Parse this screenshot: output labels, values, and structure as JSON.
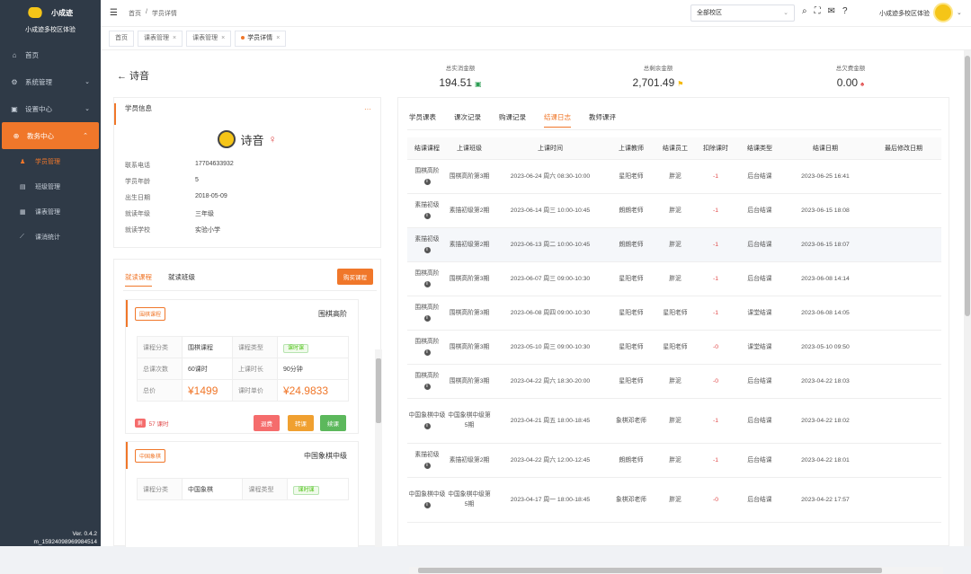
{
  "sidebar": {
    "brand": "小成迹",
    "brand_sub": "小成迹多校区体验",
    "items": [
      {
        "label": "首页",
        "icon": "home-icon"
      },
      {
        "label": "系统管理",
        "icon": "gear-icon"
      },
      {
        "label": "设置中心",
        "icon": "settings-icon"
      },
      {
        "label": "教务中心",
        "icon": "edu-icon"
      }
    ],
    "sub_items": [
      {
        "label": "学员管理"
      },
      {
        "label": "班级管理"
      },
      {
        "label": "课表管理"
      },
      {
        "label": "课消统计"
      }
    ],
    "version": "Ver. 0.4.2",
    "account": "m_15924098969984514"
  },
  "header": {
    "crumb_home": "首页",
    "crumb_sep": "/",
    "crumb_current": "学员详情",
    "campus": "全部校区",
    "user": "小成迹多校区体验"
  },
  "tabs": [
    {
      "label": "首页"
    },
    {
      "label": "课表管理"
    },
    {
      "label": "课表管理"
    },
    {
      "label": "学员详情"
    }
  ],
  "stats": [
    {
      "label": "总实消金额",
      "value": "194.51"
    },
    {
      "label": "总剩余金额",
      "value": "2,701.49"
    },
    {
      "label": "总欠费金额",
      "value": "0.00"
    }
  ],
  "student": {
    "back": "← 诗音",
    "section": "学员信息",
    "more": "···",
    "name": "诗音",
    "gender": "♀",
    "fields": [
      {
        "k": "联系电话",
        "v": "17704633932"
      },
      {
        "k": "学员年龄",
        "v": "5"
      },
      {
        "k": "出生日期",
        "v": "2018-05-09"
      },
      {
        "k": "就读年级",
        "v": "三年级"
      },
      {
        "k": "就读学校",
        "v": "实验小学"
      }
    ]
  },
  "courses": {
    "tab1": "就读课程",
    "tab2": "就读班级",
    "buy": "购买课程",
    "card1": {
      "tag": "围棋课程",
      "title": "围棋高阶",
      "k1": "课程分类",
      "v1": "围棋课程",
      "k2": "课程类型",
      "v2": "课时课",
      "k3": "总课次数",
      "v3": "60课时",
      "k4": "上课时长",
      "v4": "90分钟",
      "k5": "总价",
      "v5": "¥1499",
      "k6": "课时单价",
      "v6": "¥24.9833",
      "badge": "剩",
      "remain": "57 课时",
      "btn1": "退费",
      "btn2": "转课",
      "btn3": "续课"
    },
    "card2": {
      "tag": "中国象棋",
      "title": "中国象棋中级",
      "k1": "课程分类",
      "v1": "中国象棋",
      "k2": "课程类型",
      "v2": "课时课"
    }
  },
  "log_tabs": [
    "学员课表",
    "课次记录",
    "购课记录",
    "结课日志",
    "教师课评"
  ],
  "log_headers": [
    "结课课程",
    "上课班级",
    "上课时间",
    "上课教师",
    "结课员工",
    "扣除课时",
    "结课类型",
    "结课日期",
    "最后修改日期"
  ],
  "log_rows": [
    {
      "course": "围棋高阶",
      "cls": "围棋高阶第3期",
      "time": "2023-06-24 周六 08:30-10:00",
      "teacher": "星阳老师",
      "staff": "胖泥",
      "deduct": "-1",
      "type": "后台结课",
      "date": "2023-06-25 16:41"
    },
    {
      "course": "素描初级",
      "cls": "素描初级第2期",
      "time": "2023-06-14 周三 10:00-10:45",
      "teacher": "朗朗老师",
      "staff": "胖泥",
      "deduct": "-1",
      "type": "后台结课",
      "date": "2023-06-15 18:08"
    },
    {
      "course": "素描初级",
      "cls": "素描初级第2期",
      "time": "2023-06-13 周二 10:00-10:45",
      "teacher": "朗朗老师",
      "staff": "胖泥",
      "deduct": "-1",
      "type": "后台结课",
      "date": "2023-06-15 18:07"
    },
    {
      "course": "围棋高阶",
      "cls": "围棋高阶第3期",
      "time": "2023-06-07 周三 09:00-10:30",
      "teacher": "星阳老师",
      "staff": "胖泥",
      "deduct": "-1",
      "type": "后台结课",
      "date": "2023-06-08 14:14"
    },
    {
      "course": "围棋高阶",
      "cls": "围棋高阶第3期",
      "time": "2023-06-08 周四 09:00-10:30",
      "teacher": "星阳老师",
      "staff": "星阳老师",
      "deduct": "-1",
      "type": "课堂结课",
      "date": "2023-06-08 14:05"
    },
    {
      "course": "围棋高阶",
      "cls": "围棋高阶第3期",
      "time": "2023-05-10 周三 09:00-10:30",
      "teacher": "星阳老师",
      "staff": "星阳老师",
      "deduct": "-0",
      "type": "课堂结课",
      "date": "2023-05-10 09:50"
    },
    {
      "course": "围棋高阶",
      "cls": "围棋高阶第3期",
      "time": "2023-04-22 周六 18:30-20:00",
      "teacher": "星阳老师",
      "staff": "胖泥",
      "deduct": "-0",
      "type": "后台结课",
      "date": "2023-04-22 18:03"
    },
    {
      "course": "中国象棋中级",
      "cls": "中国象棋中级第5期",
      "time": "2023-04-21 周五 18:00-18:45",
      "teacher": "象棋邓老师",
      "staff": "胖泥",
      "deduct": "-1",
      "type": "后台结课",
      "date": "2023-04-22 18:02"
    },
    {
      "course": "素描初级",
      "cls": "素描初级第2期",
      "time": "2023-04-22 周六 12:00-12:45",
      "teacher": "朗朗老师",
      "staff": "胖泥",
      "deduct": "-1",
      "type": "后台结课",
      "date": "2023-04-22 18:01"
    },
    {
      "course": "中国象棋中级",
      "cls": "中国象棋中级第5期",
      "time": "2023-04-17 周一 18:00-18:45",
      "teacher": "象棋邓老师",
      "staff": "胖泥",
      "deduct": "-0",
      "type": "后台结课",
      "date": "2023-04-22 17:57"
    }
  ],
  "colors": {
    "accent": "#f0772a",
    "sidebar": "#2f3a47",
    "green": "#5cb85c",
    "red": "#f56c6c",
    "orange": "#f0a030"
  }
}
